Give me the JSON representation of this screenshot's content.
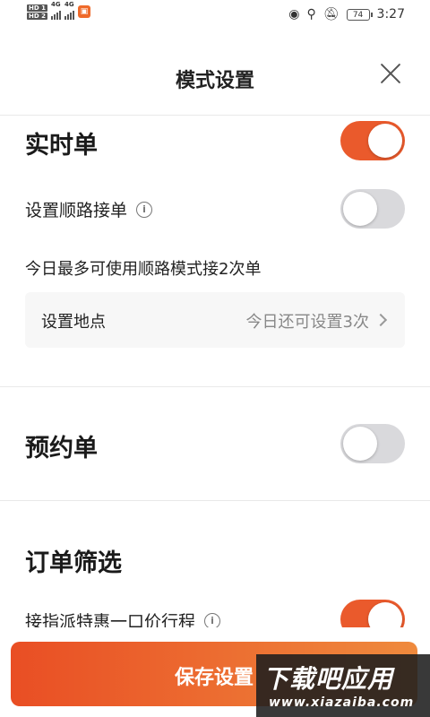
{
  "status_bar": {
    "hd1": "HD 1",
    "hd2": "HD 2",
    "net1": "4G",
    "net2": "4G",
    "battery": "74",
    "time": "3:27"
  },
  "header": {
    "title": "模式设置"
  },
  "realtime": {
    "title": "实时单",
    "enabled": true,
    "route_label": "设置顺路接单",
    "route_enabled": false,
    "route_note": "今日最多可使用顺路模式接2次单",
    "location_label": "设置地点",
    "location_value": "今日还可设置3次"
  },
  "reservation": {
    "title": "预约单",
    "enabled": false
  },
  "filter": {
    "title": "订单筛选",
    "item_label": "接指派特惠一口价行程",
    "item_enabled": true
  },
  "footer": {
    "save_label": "保存设置"
  },
  "watermark": {
    "text": "下载吧应用",
    "url_text": "www.xiazaiba.com"
  },
  "colors": {
    "accent": "#ea5a2c",
    "toggle_off": "#d9d9dc"
  }
}
